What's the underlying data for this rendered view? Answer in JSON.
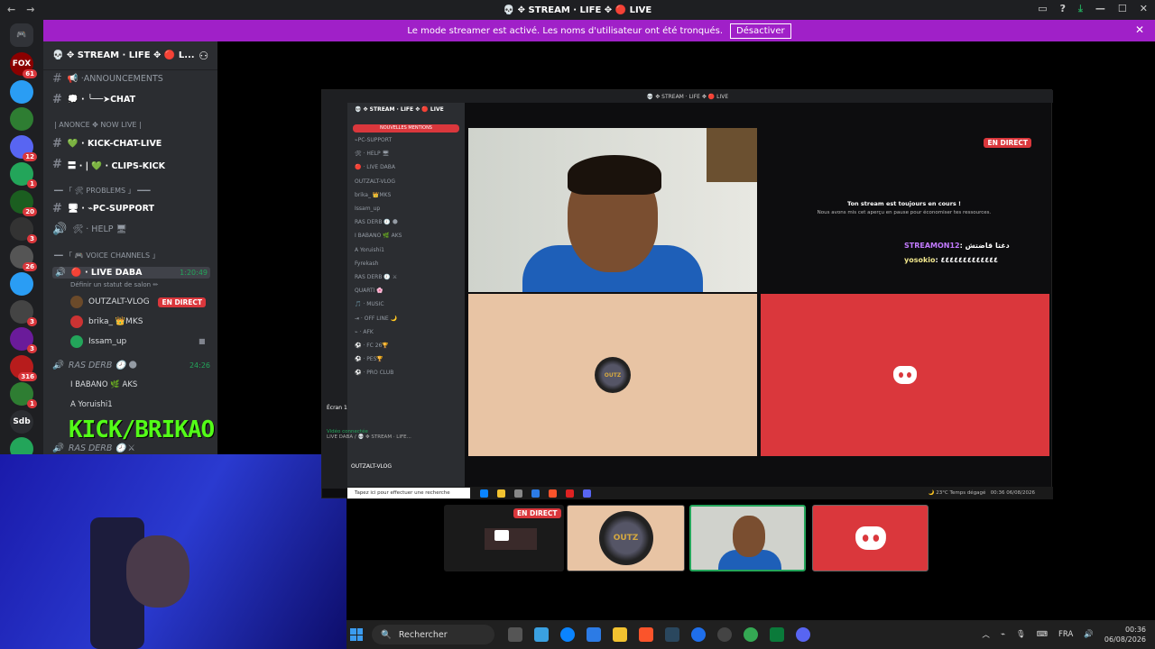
{
  "window_title": "💀 ✥ STREAM · LIFE ✥ 🔴 LIVE",
  "banner": {
    "text": "Le mode streamer est activé. Les noms d'utilisateur ont été tronqués.",
    "button": "Désactiver"
  },
  "server": {
    "name": "💀 ✥ STREAM · LIFE ✥ 🔴 L..."
  },
  "guilds": [
    {
      "label": "FOX",
      "badge": "61"
    },
    {
      "label": "",
      "badge": ""
    },
    {
      "label": "",
      "badge": ""
    },
    {
      "label": "",
      "badge": "12"
    },
    {
      "label": "",
      "badge": "1"
    },
    {
      "label": "",
      "badge": "20"
    },
    {
      "label": "",
      "badge": "3"
    },
    {
      "label": "",
      "badge": "26"
    },
    {
      "label": "",
      "badge": ""
    },
    {
      "label": "",
      "badge": "3"
    },
    {
      "label": "",
      "badge": "3"
    },
    {
      "label": "",
      "badge": "316"
    },
    {
      "label": "",
      "badge": "1"
    },
    {
      "label": "Sdb",
      "badge": ""
    },
    {
      "label": "",
      "badge": "1"
    }
  ],
  "channels": {
    "announcements": "📢 ·ANNOUNCEMENTS",
    "chat": "💭 · ╰──➤CHAT",
    "cat_live": "| ANONCE ✥ NOW LIVE |",
    "kick_chat": "💚 · KICK-CHAT-LIVE",
    "clips": "〓 · | 💚 · CLIPS-KICK",
    "cat_problems": "━━ 「 🛠 PROBLEMS 」 ━━━",
    "pc_support": "🖥 · ⌁PC-SUPPORT",
    "help": "🛠 · HELP 🖥",
    "cat_voice": "━━ 「 🎮 VOICE CHANNELS 」",
    "live_daba": "🔴 · LIVE DABA",
    "live_daba_time": "1:20:49",
    "status_hint": "Définir un statut de salon ✏",
    "ras_derb": "RAS DERB 🕗 🌑",
    "ras_derb_time": "24:26",
    "ras_derb2": "RAS DERB 🕗 ⚔"
  },
  "voice_users": [
    {
      "name": "OUTZALT-VLOG",
      "tag": "EN DIRECT"
    },
    {
      "name": "brika_ 👑MKS",
      "tag": ""
    },
    {
      "name": "Issam_up",
      "tag": ""
    }
  ],
  "ras_users": [
    {
      "name": "I BABANO 🌿 AKS"
    },
    {
      "name": "A Yoruishi1"
    }
  ],
  "overlay_kick": "KICK/BRIKAO",
  "inner": {
    "title": "💀 ✥ STREAM · LIFE ✥ 🔴 LIVE",
    "new_mentions": "NOUVELLES MENTIONS",
    "ecran": "Écran 1",
    "voice_connected": "Vidéo connectée",
    "voice_channel": "LIVE DABA / 💀 ✥ STREAM · LIFE...",
    "user": "OUTZALT-VLOG",
    "stream_still": "Ton stream est toujours en cours !",
    "stream_paused": "Nous avons mis cet aperçu en pause pour économiser tes ressources.",
    "live_tag": "EN DIRECT",
    "taskbar_search": "Tapez ici pour effectuer une recherche",
    "weather": "🌙 23°C Temps dégagé",
    "clock": "00:36",
    "date": "06/08/2026",
    "channels": [
      "⌁PC-SUPPORT",
      "🛠 · HELP 🖥",
      "🔴 · LIVE DABA",
      "OUTZALT-VLOG",
      "brika_ 👑MKS",
      "Issam_up",
      "RAS DERB 🕗 🌑",
      "I BABANO 🌿 AKS",
      "A Yoruishi1",
      "Fyrekash",
      "RAS DERB 🕗 ⚔",
      "QUARTI 🌸",
      "🎵 · MUSIC",
      "⇥ · OFF LINE 🌙",
      "⌁ · AFK",
      "⚽ · FC 26🏆",
      "⚽ · PES🏆",
      "⚽ · PRO CLUB"
    ]
  },
  "chat_lines": [
    {
      "user": "STREAMON12",
      "msg": ": دغتا قاضتش",
      "color": "#c27aff"
    },
    {
      "user": "yosokio",
      "msg": ": ٤٤٤٤٤٤٤٤٤٤٤٤٤",
      "color": "#f0e68c"
    }
  ],
  "thumb_live": "EN DIRECT",
  "taskbar": {
    "search": "Rechercher",
    "lang": "FRA",
    "time": "00:36",
    "date": "06/08/2026"
  }
}
